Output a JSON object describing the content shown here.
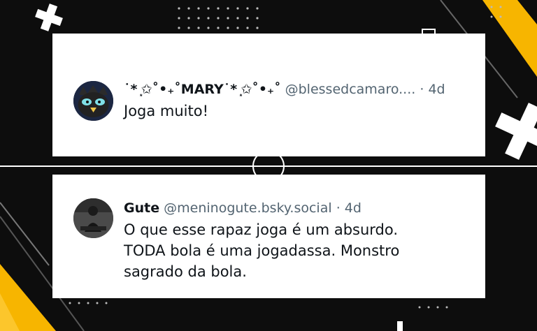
{
  "posts": [
    {
      "display_name": "˙* ͙✩˚•₊˚MARY˙* ͙✩˚•₊˚",
      "handle": "@blessedcamaro....",
      "separator": "·",
      "time": "4d",
      "text": "Joga muito!",
      "avatar_icon": "cartoon-bird-avatar"
    },
    {
      "display_name": "Gute",
      "handle": "@meninogute.bsky.social",
      "separator": "·",
      "time": "4d",
      "text": "O que esse rapaz joga é um absurdo.\nTODA bola é uma jogadassa. Monstro\nsagrado da bola.",
      "avatar_icon": "person-photo-avatar"
    }
  ],
  "colors": {
    "background": "#0d0d0d",
    "accent": "#f7b500",
    "card": "#ffffff"
  }
}
